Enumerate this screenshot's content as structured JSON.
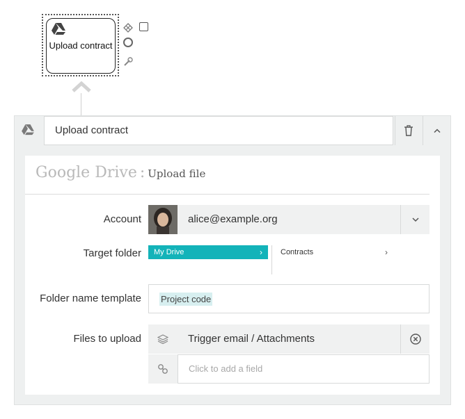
{
  "canvas": {
    "node_label": "Upload contract",
    "node_icon": "google-drive-icon",
    "context_pad": [
      "gateway-icon",
      "task-icon",
      "event-icon",
      "wrench-icon"
    ]
  },
  "panel": {
    "title_value": "Upload contract",
    "app_icon": "google-drive-icon",
    "heading_app": "Google Drive",
    "heading_separator": ":",
    "heading_action": "Upload file",
    "fields": {
      "account": {
        "label": "Account",
        "value": "alice@example.org"
      },
      "target_folder": {
        "label": "Target folder",
        "current": "My Drive",
        "next": "Contracts"
      },
      "folder_name_template": {
        "label": "Folder name template",
        "token": "Project code"
      },
      "files_to_upload": {
        "label": "Files to upload",
        "value": "Trigger email / Attachments",
        "placeholder": "Click to add a field"
      }
    }
  },
  "colors": {
    "accent": "#13b3b9",
    "panel_bg": "#eef0f0",
    "token_bg": "#d7eff0"
  }
}
